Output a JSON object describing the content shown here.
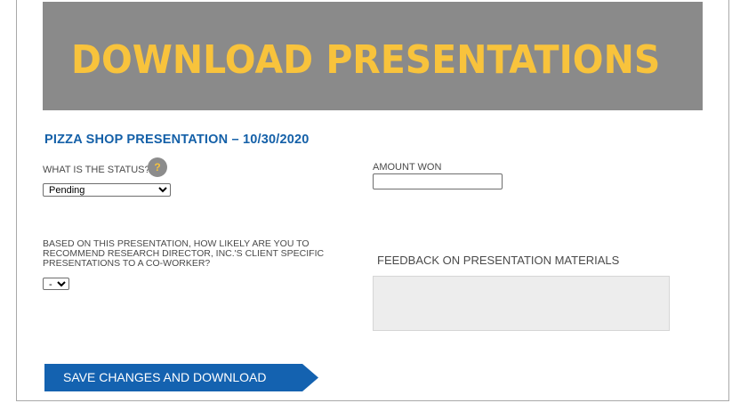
{
  "banner": {
    "title": "DOWNLOAD PRESENTATIONS"
  },
  "section": {
    "title": "PIZZA SHOP PRESENTATION – 10/30/2020"
  },
  "status": {
    "label": "WHAT IS THE STATUS?",
    "help_icon": "?",
    "selected": "Pending"
  },
  "amount": {
    "label": "AMOUNT WON",
    "value": ""
  },
  "recommend": {
    "label_lines": [
      "BASED ON THIS PRESENTATION, HOW LIKELY ARE YOU TO",
      "RECOMMEND RESEARCH DIRECTOR, INC.'S CLIENT SPECIFIC",
      "PRESENTATIONS TO A CO-WORKER?"
    ],
    "selected": "-"
  },
  "feedback": {
    "label": "FEEDBACK ON PRESENTATION MATERIALS",
    "value": ""
  },
  "actions": {
    "save_label": "SAVE CHANGES AND DOWNLOAD"
  },
  "colors": {
    "banner_bg": "#8a8a8a",
    "banner_text": "#f8c33c",
    "accent_blue": "#1462b0",
    "section_title": "#1460a8"
  }
}
